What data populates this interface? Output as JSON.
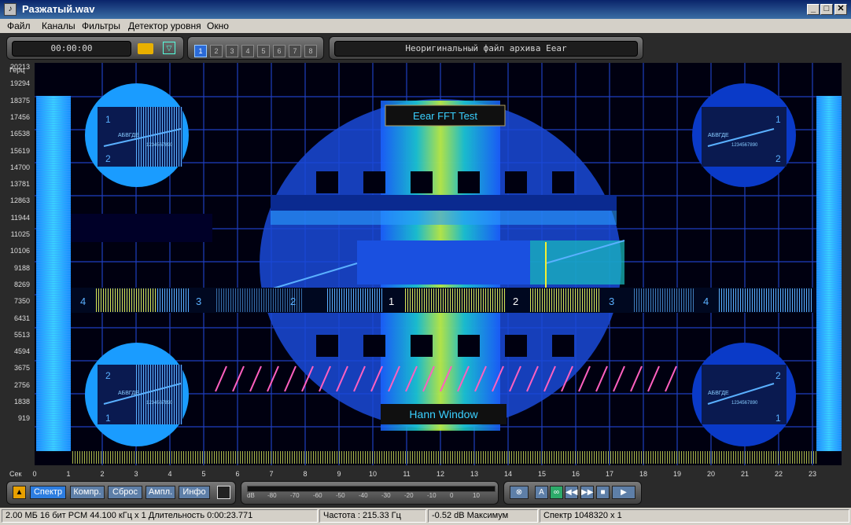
{
  "window": {
    "title": "Разжатый.wav"
  },
  "menu": [
    "Файл",
    "Каналы",
    "Фильтры",
    "Детектор уровня",
    "Окно"
  ],
  "toolbar": {
    "time": "00:00:00",
    "channels": [
      "1",
      "2",
      "3",
      "4",
      "5",
      "6",
      "7",
      "8"
    ],
    "active_channel": "1",
    "info": "Неоригинальный файл архива Eear"
  },
  "spectrogram": {
    "y_unit": "Герц",
    "x_unit": "Сек",
    "y_ticks": [
      "20213",
      "19294",
      "18375",
      "17456",
      "16538",
      "15619",
      "14700",
      "13781",
      "12863",
      "11944",
      "11025",
      "10106",
      "9188",
      "8269",
      "7350",
      "6431",
      "5513",
      "4594",
      "3675",
      "2756",
      "1838",
      "919"
    ],
    "x_ticks": [
      "0",
      "1",
      "2",
      "3",
      "4",
      "5",
      "6",
      "7",
      "8",
      "9",
      "10",
      "11",
      "12",
      "13",
      "14",
      "15",
      "16",
      "17",
      "18",
      "19",
      "20",
      "21",
      "22",
      "23"
    ],
    "overlay_top": "Eear FFT Test",
    "overlay_bottom": "Hann Window",
    "circle_text": "АБВГДЕ",
    "circle_digits": "1234567890",
    "numbers": [
      "4",
      "3",
      "2",
      "1",
      "2",
      "3",
      "4"
    ],
    "corner_numbers": [
      "1",
      "2"
    ]
  },
  "controls": {
    "buttons": [
      "Спектр",
      "Компр.",
      "Сброс",
      "Ампл.",
      "Инфо"
    ],
    "db_label": "dB",
    "db_scale": [
      "-80",
      "-70",
      "-60",
      "-50",
      "-40",
      "-30",
      "-20",
      "-10",
      "0",
      "10"
    ],
    "transport_a": "A"
  },
  "status": {
    "file": "2.00 МБ 16 бит PCM 44.100 кГц x 1  Длительность 0:00:23.771",
    "freq": "Частота : 215.33 Гц",
    "max": "-0.52 dB Максимум",
    "spectrum": "Спектр 1048320 x 1"
  },
  "colors": {
    "title_bar": "#0a246a",
    "accent": "#2d7de0",
    "spectrum_bg": "#000010"
  }
}
